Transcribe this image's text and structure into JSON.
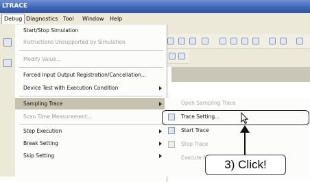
{
  "window": {
    "title": "LTRACE"
  },
  "menubar": {
    "items": [
      {
        "label": "Debug",
        "active": true
      },
      {
        "label": "Diagnostics"
      },
      {
        "label": "Tool"
      },
      {
        "label": "Window"
      },
      {
        "label": "Help"
      }
    ]
  },
  "debug_menu": {
    "items": [
      {
        "label": "Start/Stop Simulation",
        "enabled": true
      },
      {
        "label": "Instructions Unsupported by Simulation",
        "enabled": false
      },
      {
        "label": "Modify Value...",
        "enabled": false
      },
      {
        "label": "Forced Input Output Registration/Cancellation...",
        "enabled": true
      },
      {
        "label": "Device Test with Execution Condition",
        "enabled": true
      },
      {
        "label": "Sampling Trace",
        "enabled": true
      },
      {
        "label": "Scan Time Measurement...",
        "enabled": false
      },
      {
        "label": "Step Execution",
        "enabled": true
      },
      {
        "label": "Break Setting",
        "enabled": true
      },
      {
        "label": "Skip Setting",
        "enabled": true
      }
    ]
  },
  "submenu": {
    "items": [
      {
        "label": "Open Sampling Trace",
        "enabled": false
      },
      {
        "label": "Trace Setting...",
        "enabled": true
      },
      {
        "label": "Start Trace",
        "enabled": true
      },
      {
        "label": "Stop Trace",
        "enabled": false
      },
      {
        "label": "Execute Manual Trigger",
        "enabled": false
      }
    ]
  },
  "annotation": {
    "step_label": "3) Click!"
  }
}
